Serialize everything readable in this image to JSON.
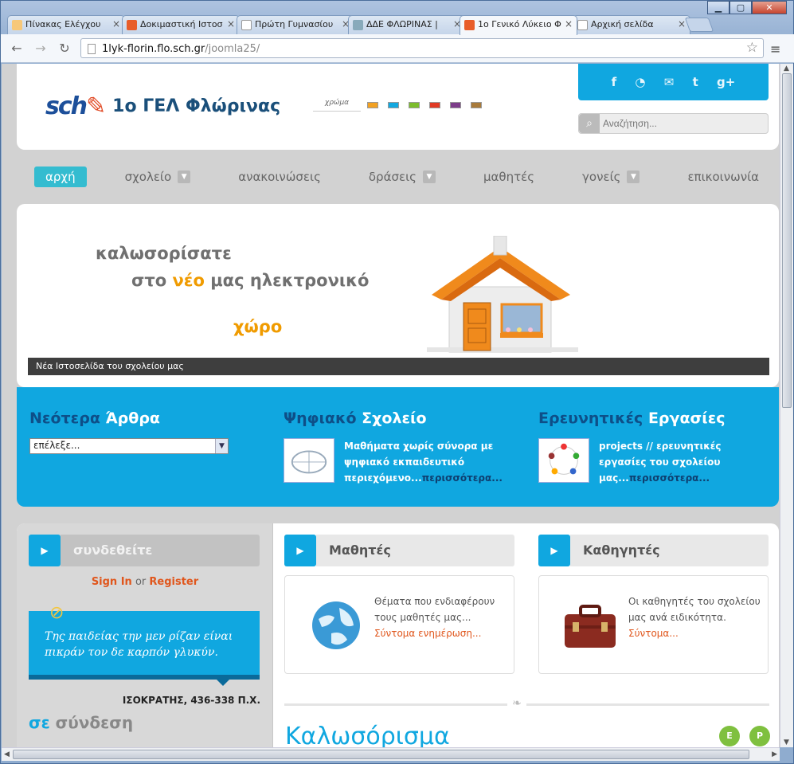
{
  "browser": {
    "tabs": [
      {
        "label": "Πίνακας Ελέγχου"
      },
      {
        "label": "Δοκιμαστική Ιστοσ"
      },
      {
        "label": "Πρώτη Γυμνασίου"
      },
      {
        "label": "ΔΔΕ ΦΛΩΡΙΝΑΣ |"
      },
      {
        "label": "1ο Γενικό Λύκειο Φ"
      },
      {
        "label": "Αρχική σελίδα"
      }
    ],
    "url_host": "1lyk-florin.flo.sch.gr",
    "url_path": "/joomla25/",
    "window_buttons": {
      "minimize": "▁",
      "maximize": "▢",
      "close": "✕"
    }
  },
  "site": {
    "logo_text": "sch",
    "school_name": "1ο ΓΕΛ Φλώρινας",
    "color_label": "χρώμα",
    "swatches": [
      "#f2a122",
      "#13a8e0",
      "#7cbc2c",
      "#e13a24",
      "#7d3d8a",
      "#a87a3a"
    ],
    "social": [
      "f",
      "rss",
      "mail",
      "t",
      "g+"
    ],
    "search_placeholder": "Αναζήτηση..."
  },
  "nav": {
    "home": "αρχή",
    "items": [
      "σχολείο",
      "ανακοινώσεις",
      "δράσεις",
      "μαθητές",
      "γονείς",
      "επικοινωνία"
    ]
  },
  "hero": {
    "line1": "καλωσορίσατε",
    "line2_a": "στο ",
    "line2_b": "νέο",
    "line2_c": " μας ηλεκτρονικό",
    "line3": "χώρο",
    "caption": "Νέα Ιστοσελίδα του σχολείου μας"
  },
  "features": {
    "articles_title_a": "Νεότερα ",
    "articles_title_b": "Άρθρα",
    "select_value": "επέλεξε...",
    "digital_title_a": "Ψηφιακό ",
    "digital_title_b": "Σχολείο",
    "digital_text": "Μαθήματα χωρίς σύνορα με ψηφιακό εκπαιδευτικό περιεχόμενο...",
    "digital_more": "περισσότερα...",
    "research_title_a": "Ερευνητικές ",
    "research_title_b": "Εργασίες",
    "research_text": "projects // ερευνητικές εργασίες του σχολείου μας...",
    "research_more": "περισσότερα..."
  },
  "login": {
    "title": "συνδεθείτε",
    "signin": "Sign In",
    "or": " or ",
    "register": "Register"
  },
  "quote": {
    "text": "Της παιδείας την μεν ρίζαν είναι πικράν τον δε καρπόν γλυκύν.",
    "author": "ΙΣΟΚΡΑΤΗΣ, 436-338 Π.Χ."
  },
  "online": {
    "a": "σε",
    "b": " σύνδεση"
  },
  "students": {
    "title": "Μαθητές",
    "text": "Θέματα που ενδιαφέρουν τους μαθητές μας...",
    "link": "Σύντομα ενημέρωση..."
  },
  "teachers": {
    "title": "Καθηγητές",
    "text": "Οι καθηγητές του σχολείου μας ανά ειδικότητα.",
    "link": "Σύντομα..."
  },
  "welcome": "Καλωσόρισμα",
  "badges": [
    "E",
    "P"
  ]
}
